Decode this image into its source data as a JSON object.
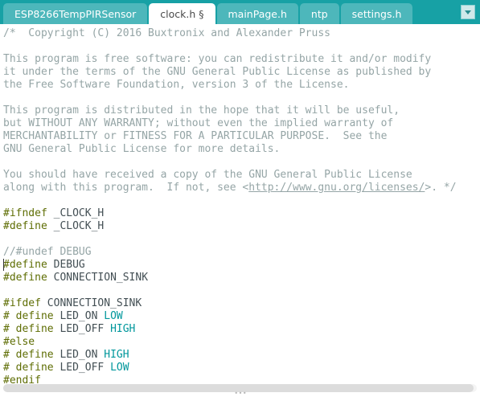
{
  "tabs": [
    {
      "label": "ESP8266TempPIRSensor",
      "active": false
    },
    {
      "label": "clock.h §",
      "active": true
    },
    {
      "label": "mainPage.h",
      "active": false
    },
    {
      "label": "ntp",
      "active": false
    },
    {
      "label": "settings.h",
      "active": false
    }
  ],
  "code": {
    "lines": [
      {
        "t": "comment",
        "text": "/*  Copyright (C) 2016 Buxtronix and Alexander Pruss"
      },
      {
        "t": "blank",
        "text": ""
      },
      {
        "t": "comment",
        "text": "This program is free software: you can redistribute it and/or modify"
      },
      {
        "t": "comment",
        "text": "it under the terms of the GNU General Public License as published by"
      },
      {
        "t": "comment",
        "text": "the Free Software Foundation, version 3 of the License."
      },
      {
        "t": "blank",
        "text": ""
      },
      {
        "t": "comment",
        "text": "This program is distributed in the hope that it will be useful,"
      },
      {
        "t": "comment",
        "text": "but WITHOUT ANY WARRANTY; without even the implied warranty of"
      },
      {
        "t": "comment",
        "text": "MERCHANTABILITY or FITNESS FOR A PARTICULAR PURPOSE.  See the"
      },
      {
        "t": "comment",
        "text": "GNU General Public License for more details."
      },
      {
        "t": "blank",
        "text": ""
      },
      {
        "t": "comment",
        "text": "You should have received a copy of the GNU General Public License"
      },
      {
        "t": "comment_link",
        "before": "along with this program.  If not, see <",
        "link": "http://www.gnu.org/licenses/",
        "after": ">. */"
      },
      {
        "t": "blank",
        "text": ""
      },
      {
        "t": "pre_id",
        "kw": "#ifndef",
        "rest": " _CLOCK_H"
      },
      {
        "t": "pre_id",
        "kw": "#define",
        "rest": " _CLOCK_H"
      },
      {
        "t": "blank",
        "text": ""
      },
      {
        "t": "comment",
        "text": "//#undef DEBUG"
      },
      {
        "t": "pre_id",
        "kw": "#define",
        "rest": " DEBUG"
      },
      {
        "t": "pre_id",
        "kw": "#define",
        "rest": " CONNECTION_SINK"
      },
      {
        "t": "blank",
        "text": ""
      },
      {
        "t": "pre_id",
        "kw": "#ifdef",
        "rest": " CONNECTION_SINK"
      },
      {
        "t": "pre_lit",
        "kw": "# define",
        "mid": " LED_ON ",
        "lit": "LOW"
      },
      {
        "t": "pre_lit",
        "kw": "# define",
        "mid": " LED_OFF ",
        "lit": "HIGH"
      },
      {
        "t": "pre",
        "kw": "#else"
      },
      {
        "t": "pre_lit",
        "kw": "# define",
        "mid": " LED_ON ",
        "lit": "HIGH"
      },
      {
        "t": "pre_lit",
        "kw": "# define",
        "mid": " LED_OFF ",
        "lit": "LOW"
      },
      {
        "t": "pre",
        "kw": "#endif"
      }
    ]
  },
  "cursor": {
    "line": 18,
    "col": 0
  }
}
